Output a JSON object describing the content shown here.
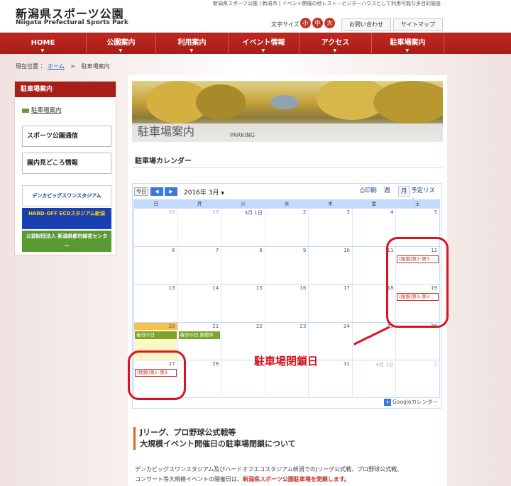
{
  "header": {
    "logo_jp": "新潟県スポーツ公園",
    "logo_en": "Niigata Prefectural Sports Park",
    "tagline": "新潟県スポーツ公園 | 新潟市 | イベント開催の他レスト・ビジターハウスとして利用可能な多目的施設",
    "font_size_label": "文字サイズ",
    "font_sizes": [
      "小",
      "中",
      "大"
    ],
    "contact": "お問い合わせ",
    "sitemap": "サイトマップ"
  },
  "nav": [
    "HOME",
    "公園案内",
    "利用案内",
    "イベント情報",
    "アクセス",
    "駐車場案内"
  ],
  "breadcrumb": {
    "prefix": "現在位置 ：",
    "home": "ホーム",
    "sep": ">",
    "current": "駐車場案内"
  },
  "sidebar": {
    "heading": "駐車場案内",
    "link": "駐車場案内",
    "banners": [
      "スポーツ公園通信",
      "園内見どころ情報"
    ],
    "logos": [
      "デンカビッグスワンスタジアム",
      "HARD-OFF ECOスタジアム新潟",
      "公益財団法人 新潟県都市緑花センター"
    ]
  },
  "page": {
    "title_jp": "駐車場案内",
    "title_en": "PARKING",
    "calendar_heading": "駐車場カレンダー"
  },
  "calendar": {
    "today": "今日",
    "prev": "◀",
    "next": "▶",
    "month": "2016年 3月",
    "print": "印刷",
    "views": [
      "週",
      "月",
      "予定リスト"
    ],
    "dows": [
      "日",
      "月",
      "火",
      "水",
      "木",
      "金",
      "土"
    ],
    "weeks": [
      [
        {
          "d": "28",
          "o": true
        },
        {
          "d": "29",
          "o": true
        },
        {
          "d": "3月 1日"
        },
        {
          "d": "2"
        },
        {
          "d": "3"
        },
        {
          "d": "4"
        },
        {
          "d": "5"
        }
      ],
      [
        {
          "d": "6"
        },
        {
          "d": "7"
        },
        {
          "d": "8"
        },
        {
          "d": "9"
        },
        {
          "d": "10"
        },
        {
          "d": "11"
        },
        {
          "d": "12",
          "ev": "[閉鎖]第1･第3",
          "evc": "red"
        }
      ],
      [
        {
          "d": "13"
        },
        {
          "d": "14"
        },
        {
          "d": "15"
        },
        {
          "d": "16"
        },
        {
          "d": "17"
        },
        {
          "d": "18"
        },
        {
          "d": "19",
          "ev": "[閉鎖]第1･第3",
          "evc": "red"
        }
      ],
      [
        {
          "d": "20",
          "today": true,
          "ev": "春分の日",
          "evc": "green"
        },
        {
          "d": "21",
          "ev": "春分の日 振替休",
          "evc": "green"
        },
        {
          "d": "22"
        },
        {
          "d": "23"
        },
        {
          "d": "24"
        },
        {
          "d": "25"
        },
        {
          "d": "26"
        }
      ],
      [
        {
          "d": "27",
          "ev": "[閉鎖]第1･第3",
          "evc": "red"
        },
        {
          "d": "28"
        },
        {
          "d": "29"
        },
        {
          "d": "30"
        },
        {
          "d": "31"
        },
        {
          "d": "4月 1日",
          "o": true
        },
        {
          "d": "2",
          "o": true
        }
      ]
    ],
    "footer": "Googleカレンダー"
  },
  "annotation": "駐車場閉鎖日",
  "section": {
    "title_line1": "Jリーグ、プロ野球公式戦等",
    "title_line2": "大規模イベント開催日の駐車場閉鎖について",
    "body_line1": "デンカビッグスワンスタジアム及びハードオフエコスタジアム新潟でのJリーグ公式戦、プロ野球公式戦、",
    "body_line2_a": "コンサート等大規模イベントの開催日は、",
    "body_line2_b": "新潟県スポーツ公園駐車場を閉鎖します。"
  },
  "colors": {
    "brand_red": "#a81e19",
    "accent_red": "#d9141e",
    "calendar_blue": "#c3d9ff",
    "today_yellow": "#f6c04d",
    "holiday_green": "#7ba62a"
  }
}
